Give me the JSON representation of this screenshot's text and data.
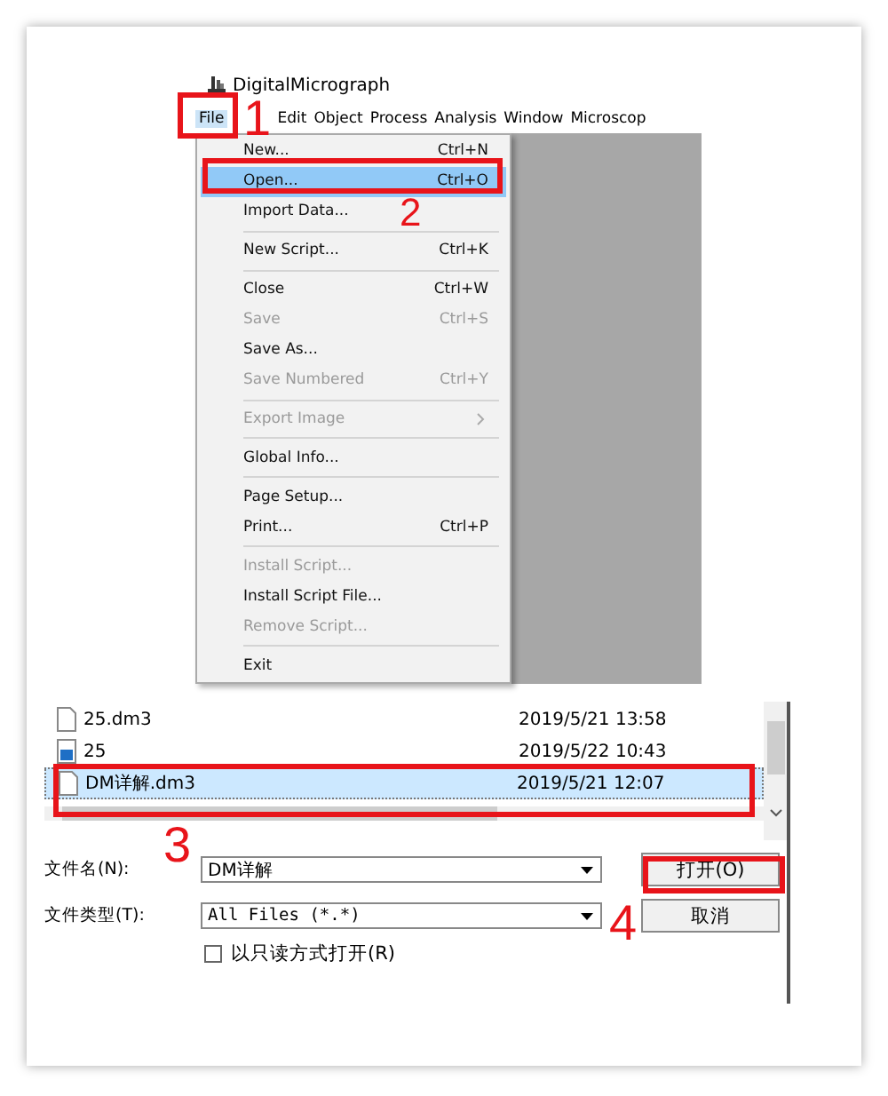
{
  "app": {
    "title": "DigitalMicrograph",
    "menu": [
      {
        "label": "File",
        "selected": true
      },
      {
        "label": "Edit",
        "selected": false
      },
      {
        "label": "Object",
        "selected": false
      },
      {
        "label": "Process",
        "selected": false
      },
      {
        "label": "Analysis",
        "selected": false
      },
      {
        "label": "Window",
        "selected": false
      },
      {
        "label": "Microscop",
        "selected": false
      }
    ]
  },
  "file_menu": [
    {
      "kind": "item",
      "label": "New...",
      "shortcut": "Ctrl+N",
      "disabled": false,
      "selected": false
    },
    {
      "kind": "item",
      "label": "Open...",
      "shortcut": "Ctrl+O",
      "disabled": false,
      "selected": true
    },
    {
      "kind": "item",
      "label": "Import Data...",
      "disabled": false,
      "selected": false
    },
    {
      "kind": "separator"
    },
    {
      "kind": "item",
      "label": "New Script...",
      "shortcut": "Ctrl+K",
      "disabled": false,
      "selected": false
    },
    {
      "kind": "separator"
    },
    {
      "kind": "item",
      "label": "Close",
      "shortcut": "Ctrl+W",
      "disabled": false,
      "selected": false
    },
    {
      "kind": "item",
      "label": "Save",
      "shortcut": "Ctrl+S",
      "disabled": true,
      "selected": false
    },
    {
      "kind": "item",
      "label": "Save As...",
      "disabled": false,
      "selected": false
    },
    {
      "kind": "item",
      "label": "Save Numbered",
      "shortcut": "Ctrl+Y",
      "disabled": true,
      "selected": false
    },
    {
      "kind": "separator"
    },
    {
      "kind": "submenu",
      "label": "Export Image",
      "disabled": true,
      "selected": false
    },
    {
      "kind": "separator"
    },
    {
      "kind": "item",
      "label": "Global Info...",
      "disabled": false,
      "selected": false
    },
    {
      "kind": "separator"
    },
    {
      "kind": "item",
      "label": "Page Setup...",
      "disabled": false,
      "selected": false
    },
    {
      "kind": "item",
      "label": "Print...",
      "shortcut": "Ctrl+P",
      "disabled": false,
      "selected": false
    },
    {
      "kind": "separator"
    },
    {
      "kind": "item",
      "label": "Install Script...",
      "disabled": true,
      "selected": false
    },
    {
      "kind": "item",
      "label": "Install Script File...",
      "disabled": false,
      "selected": false
    },
    {
      "kind": "item",
      "label": "Remove Script...",
      "disabled": true,
      "selected": false
    },
    {
      "kind": "separator"
    },
    {
      "kind": "item",
      "label": "Exit",
      "disabled": false,
      "selected": false
    }
  ],
  "open_dialog": {
    "files": [
      {
        "kind": "document",
        "name": "25.dm3",
        "date": "2019/5/21 13:58",
        "selected": false
      },
      {
        "kind": "image",
        "name": "25",
        "date": "2019/5/22 10:43",
        "selected": false
      },
      {
        "kind": "document",
        "name": "DM详解.dm3",
        "date": "2019/5/21 12:07",
        "selected": true
      }
    ],
    "file_name": {
      "label": "文件名(N):",
      "value": "DM详解"
    },
    "file_type": {
      "label": "文件类型(T):",
      "value": "All Files (*.*)"
    },
    "read_only": {
      "label": "以只读方式打开(R)",
      "checked": false
    },
    "buttons": [
      "打开(O)",
      "取消"
    ]
  },
  "callouts": [
    "1",
    "2",
    "3",
    "4"
  ]
}
